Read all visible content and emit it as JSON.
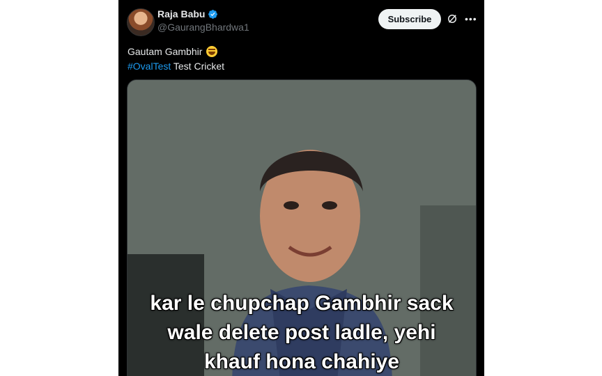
{
  "user": {
    "display_name": "Raja Babu",
    "handle": "@GaurangBhardwa1",
    "verified": true
  },
  "actions": {
    "subscribe_label": "Subscribe",
    "grok_icon": "grok-icon",
    "more_icon": "more-icon"
  },
  "tweet": {
    "line1": "Gautam Gambhir",
    "emoji": "rolling-on-floor-laughing",
    "hashtag": "#OvalTest",
    "line2_rest": " Test Cricket"
  },
  "media": {
    "caption_lines": [
      "kar le chupchap Gambhir sack",
      "wale delete post ladle, yehi",
      "khauf hona chahiye"
    ]
  },
  "colors": {
    "background": "#000000",
    "text": "#e7e9ea",
    "secondary_text": "#71767b",
    "link": "#1d9bf0",
    "verified": "#1d9bf0",
    "subscribe_bg": "#eff3f4"
  }
}
